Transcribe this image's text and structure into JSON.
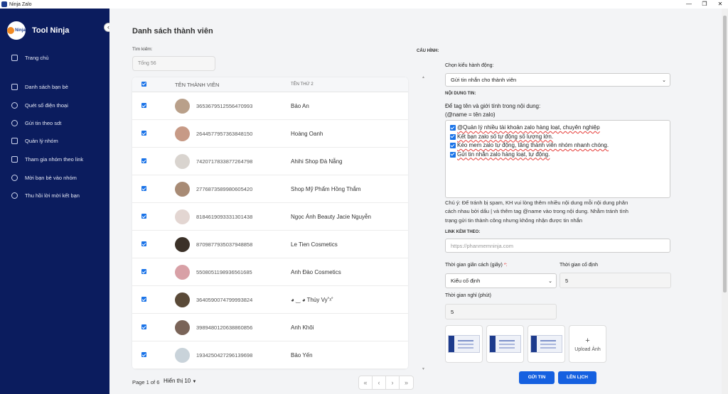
{
  "window": {
    "title": "Ninja Zalo",
    "controls": [
      "—",
      "❐",
      "✕"
    ]
  },
  "sidebar": {
    "brand": "Tool Ninja",
    "logo_text": "Ninja",
    "collapse_icon": "‹",
    "items": [
      {
        "label": "Trang chủ",
        "icon": "chart-icon"
      },
      {
        "label": "Danh sách bạn bè",
        "icon": "contacts-icon"
      },
      {
        "label": "Quét số điện thoại",
        "icon": "search-icon"
      },
      {
        "label": "Gửi tin theo sdt",
        "icon": "message-icon"
      },
      {
        "label": "Quản lý nhóm",
        "icon": "analytics-icon"
      },
      {
        "label": "Tham gia nhóm theo link",
        "icon": "mail-icon"
      },
      {
        "label": "Mời bạn bè vào nhóm",
        "icon": "gear-icon"
      },
      {
        "label": "Thu hồi lời mời kết bạn",
        "icon": "gear-icon"
      }
    ]
  },
  "members": {
    "title": "Danh sách thành viên",
    "search_label": "Tìm kiếm:",
    "search_placeholder": "Tổng 56",
    "columns": [
      "TÊN THÀNH VIÊN",
      "TÊN THỨ 2"
    ],
    "rows": [
      {
        "id": "3653679512556470993",
        "name": "Bảo An",
        "avatar_color": "#b9a08a"
      },
      {
        "id": "2644577957363848150",
        "name": "Hoàng Oanh",
        "avatar_color": "#c79a86"
      },
      {
        "id": "7420717833877264798",
        "name": "Ahihi Shop Đà Nẵng",
        "avatar_color": "#d9d4cf"
      },
      {
        "id": "2776873589980605420",
        "name": "Shop Mỹ Phẩm Hồng Thắm",
        "avatar_color": "#a88b75"
      },
      {
        "id": "8184619093331301438",
        "name": "Ngọc Ánh Beauty Jacie Nguyễn",
        "avatar_color": "#e3d6d2"
      },
      {
        "id": "8709877935037948858",
        "name": "Le Tien Cosmetics",
        "avatar_color": "#3b3128"
      },
      {
        "id": "5508051198936561685",
        "name": "Anh Đào Cosmetics",
        "avatar_color": "#d8a0a6"
      },
      {
        "id": "3640590074799993824",
        "name": "◕ ‿ ◕ Thùy Vy˚ᵡ˚",
        "avatar_color": "#5a4a38"
      },
      {
        "id": "3989480120638860856",
        "name": "Anh Khôi",
        "avatar_color": "#7a6458"
      },
      {
        "id": "1934250427296139698",
        "name": "Bảo Yến",
        "avatar_color": "#c9d3da"
      }
    ],
    "pagination": {
      "label": "Page 1 of 6",
      "per_page": "Hiển thị 10",
      "buttons": [
        "«",
        "‹",
        "›",
        "»"
      ]
    }
  },
  "config": {
    "title": "CẤU HÌNH:",
    "action_label": "Chọn kiểu hành động:",
    "action_value": "Gửi tin nhắn cho thành viên",
    "content_label": "NỘI DUNG TIN:",
    "tag_hint_1": "Để tag tên và giới tính trong nội dung:",
    "tag_hint_2": "(@name = tên zalo)",
    "content_lines": [
      "@Quản lý nhiều tài khoản zalo hàng loạt, chuyên nghiệp",
      "Kết bạn zalo số tự động số lượng lớn.",
      "Kéo mem zalo tự động, tăng thành viên nhóm nhanh chóng.",
      "Gửi tin nhắn zalo hàng loạt, tự động."
    ],
    "note_1": "Chú ý: Để tránh bị spam, KH vui lòng thêm nhiều nội dung mỗi nội dung phân",
    "note_2": "cách nhau bởi dấu | và thêm tag @name vào trong nội dung. Nhằm tránh tình",
    "note_3": "trạng gửi tin thành công nhưng không nhận được tin nhắn",
    "link_label": "LINK KÈM THEO:",
    "link_placeholder": "https://phanmemninja.com",
    "interval_label": "Thời gian giãn cách (giây)",
    "required_mark": "*:",
    "interval_value": "Kiểu cố định",
    "fixed_time_label": "Thời gian cố định",
    "fixed_time_value": "5",
    "rest_label": "Thời gian nghỉ (phút)",
    "rest_value": "5",
    "upload_label": "Upload Ảnh",
    "upload_plus": "+",
    "send_button": "GỬI TIN",
    "schedule_button": "LÊN LỊCH"
  },
  "colors": {
    "sidebar": "#0b1c5e",
    "accent": "#1560e0",
    "checkbox": "#1a73e8"
  }
}
